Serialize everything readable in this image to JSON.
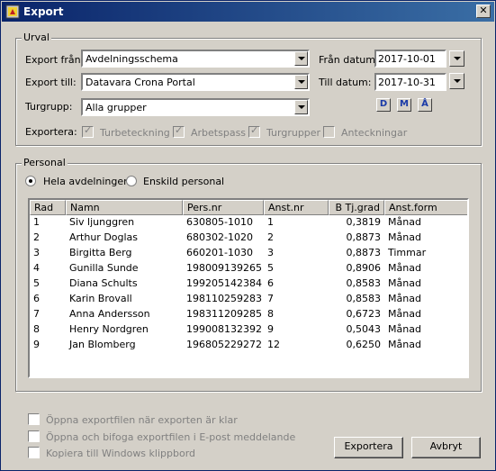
{
  "window": {
    "title": "Export",
    "close_label": "✕"
  },
  "icons": {
    "app": "export-app-icon",
    "close": "close-icon"
  },
  "urval": {
    "group_label": "Urval",
    "export_from_label": "Export från:",
    "export_from_value": "Avdelningsschema",
    "export_to_label": "Export till:",
    "export_to_value": "Datavara Crona Portal",
    "turgrupp_label": "Turgrupp:",
    "turgrupp_value": "Alla grupper",
    "from_date_label": "Från datum:",
    "from_date_value": "2017-10-01",
    "to_date_label": "Till datum:",
    "to_date_value": "2017-10-31",
    "date_buttons": [
      "D",
      "M",
      "Å"
    ],
    "exportera_label": "Exportera:",
    "exportera_options": [
      {
        "label": "Turbeteckning",
        "checked": true
      },
      {
        "label": "Arbetspass",
        "checked": true
      },
      {
        "label": "Turgrupper",
        "checked": true
      },
      {
        "label": "Anteckningar",
        "checked": false
      }
    ]
  },
  "personal": {
    "group_label": "Personal",
    "radio_all_label": "Hela avdelningen",
    "radio_single_label": "Enskild personal",
    "selected": "all",
    "columns": [
      "Rad",
      "Namn",
      "Pers.nr",
      "Anst.nr",
      "B Tj.grad",
      "Anst.form"
    ],
    "rows": [
      [
        "1",
        "Siv ljunggren",
        "630805-1010",
        "1",
        "0,3819",
        "Månad"
      ],
      [
        "2",
        "Arthur Doglas",
        "680302-1020",
        "2",
        "0,8873",
        "Månad"
      ],
      [
        "3",
        "Birgitta Berg",
        "660201-1030",
        "3",
        "0,8873",
        "Timmar"
      ],
      [
        "4",
        "Gunilla Sunde",
        "198009139265",
        "5",
        "0,8906",
        "Månad"
      ],
      [
        "5",
        "Diana Schults",
        "199205142384",
        "6",
        "0,8583",
        "Månad"
      ],
      [
        "6",
        "Karin Brovall",
        "198110259283",
        "7",
        "0,8583",
        "Månad"
      ],
      [
        "7",
        "Anna Andersson",
        "198311209285",
        "8",
        "0,6723",
        "Månad"
      ],
      [
        "8",
        "Henry Nordgren",
        "199008132392",
        "9",
        "0,5043",
        "Månad"
      ],
      [
        "9",
        "Jan Blomberg",
        "196805229272",
        "12",
        "0,6250",
        "Månad"
      ]
    ]
  },
  "options": [
    {
      "label": "Öppna exportfilen när exporten är klar",
      "checked": false
    },
    {
      "label": "Öppna och bifoga exportfilen i E-post meddelande",
      "checked": false
    },
    {
      "label": "Kopiera till Windows klippbord",
      "checked": false
    }
  ],
  "buttons": {
    "export": "Exportera",
    "cancel": "Avbryt"
  }
}
